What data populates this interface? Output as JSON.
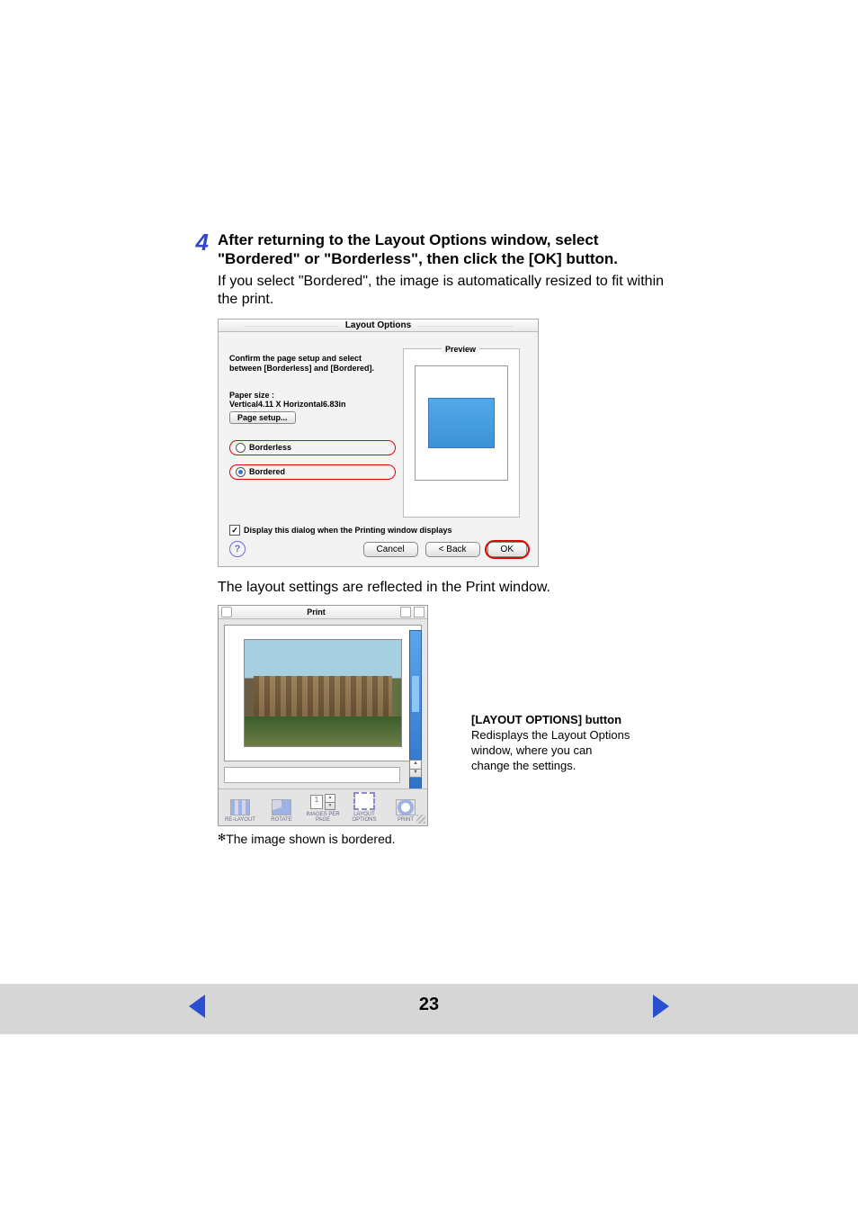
{
  "step": {
    "number": "4",
    "title": "After returning to the Layout Options window, select \"Bordered\" or \"Borderless\", then click the [OK] button.",
    "desc": "If you select \"Bordered\", the image is automatically resized to fit within the print."
  },
  "layout_options": {
    "window_title": "Layout Options",
    "confirm_line1": "Confirm the page setup and select",
    "confirm_line2": "between [Borderless] and [Bordered].",
    "paper_size_label": "Paper size :",
    "paper_size_value": "Vertical4.11 X Horizontal6.83in",
    "page_setup_button": "Page setup...",
    "option_borderless": "Borderless",
    "option_bordered": "Bordered",
    "selected": "Bordered",
    "preview_label": "Preview",
    "display_checkbox_label": "Display this dialog when the Printing window displays",
    "display_checkbox_checked": true,
    "cancel": "Cancel",
    "back": "< Back",
    "ok": "OK",
    "help": "?"
  },
  "reflected_text": "The layout settings are reflected in the Print window.",
  "print_window": {
    "title": "Print",
    "toolbar": {
      "relayout": "RE-LAYOUT",
      "rotate": "ROTATE",
      "images_per_page": "IMAGES PER PAGE",
      "images_per_page_value": "1",
      "layout_options": "LAYOUT OPTIONS",
      "print": "PRINT"
    }
  },
  "footnote": "The image shown is bordered.",
  "callout": {
    "title": "[LAYOUT OPTIONS] button",
    "body": "Redisplays the Layout Options window, where you can change the settings."
  },
  "page_number": "23"
}
